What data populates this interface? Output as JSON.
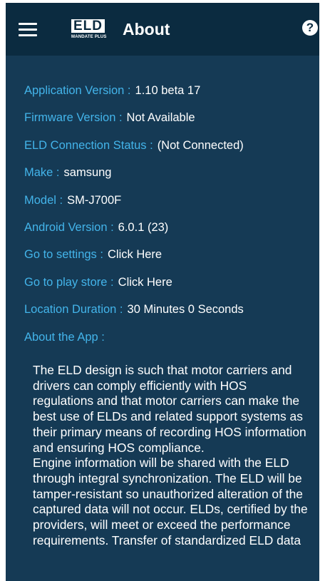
{
  "header": {
    "logo_main": "ELD",
    "logo_sub": "MANDATE PLUS",
    "title": "About"
  },
  "info": [
    {
      "label": "Application Version :",
      "value": "1.10 beta 17"
    },
    {
      "label": "Firmware Version :",
      "value": "Not Available"
    },
    {
      "label": "ELD Connection Status :",
      "value": "(Not Connected)"
    },
    {
      "label": "Make :",
      "value": "samsung"
    },
    {
      "label": "Model :",
      "value": "SM-J700F"
    },
    {
      "label": "Android Version :",
      "value": "6.0.1 (23)"
    },
    {
      "label": "Go to settings :",
      "value": "Click Here"
    },
    {
      "label": "Go to play store :",
      "value": "Click Here"
    },
    {
      "label": "Location Duration :",
      "value": "30 Minutes 0 Seconds"
    }
  ],
  "about": {
    "label": "About the App :",
    "paragraph1": "The ELD design is such that motor carriers and drivers can comply efficiently with HOS regulations and that motor carriers can make the best use of ELDs and related support systems as their primary means of recording HOS information and ensuring HOS compliance.",
    "paragraph2": "Engine information will be shared with the ELD through integral synchronization. The ELD will be tamper-resistant so unauthorized alteration of the captured data will not occur. ELDs, certified by the providers, will meet or exceed the performance requirements. Transfer of standardized ELD data"
  },
  "colors": {
    "appbar": "#0b2b40",
    "background": "#153a55",
    "label": "#43b4ea",
    "value": "#ffffff"
  }
}
